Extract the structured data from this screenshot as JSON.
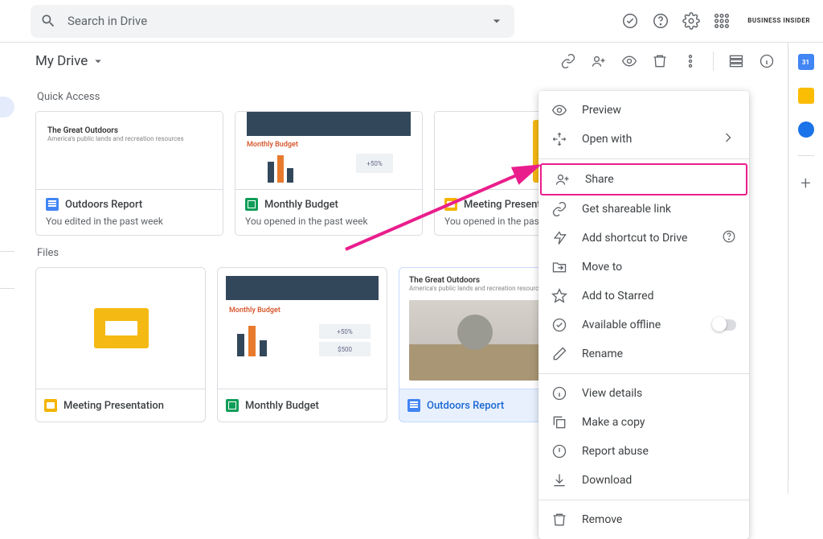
{
  "search": {
    "placeholder": "Search in Drive"
  },
  "brand": "BUSINESS INSIDER",
  "breadcrumb": "My Drive",
  "sections": {
    "quick_access": "Quick Access",
    "files": "Files"
  },
  "quick": [
    {
      "title": "Outdoors Report",
      "sub": "You edited in the past week",
      "prev_t1": "The Great Outdoors",
      "prev_t2": "America's public lands and recreation resources",
      "type": "doc"
    },
    {
      "title": "Monthly Budget",
      "sub": "You opened in the past week",
      "prev_label": "Monthly Budget",
      "prev_stat": "+50%",
      "type": "sheet"
    },
    {
      "title": "Meeting Presentation",
      "sub": "You opened in the past week",
      "type": "slide"
    }
  ],
  "files": [
    {
      "title": "Meeting Presentation",
      "type": "slide"
    },
    {
      "title": "Monthly Budget",
      "type": "sheet",
      "prev_label": "Monthly Budget",
      "prev_stat1": "+50%",
      "prev_stat2": "$500"
    },
    {
      "title": "Outdoors Report",
      "type": "doc",
      "prev_t1": "The Great Outdoors",
      "prev_t2": "America's public lands and recreation resources",
      "selected": true
    }
  ],
  "context_menu": {
    "preview": "Preview",
    "openwith": "Open with",
    "share": "Share",
    "getlink": "Get shareable link",
    "shortcut": "Add shortcut to Drive",
    "moveto": "Move to",
    "starred": "Add to Starred",
    "offline": "Available offline",
    "rename": "Rename",
    "details": "View details",
    "copy": "Make a copy",
    "abuse": "Report abuse",
    "download": "Download",
    "remove": "Remove"
  }
}
